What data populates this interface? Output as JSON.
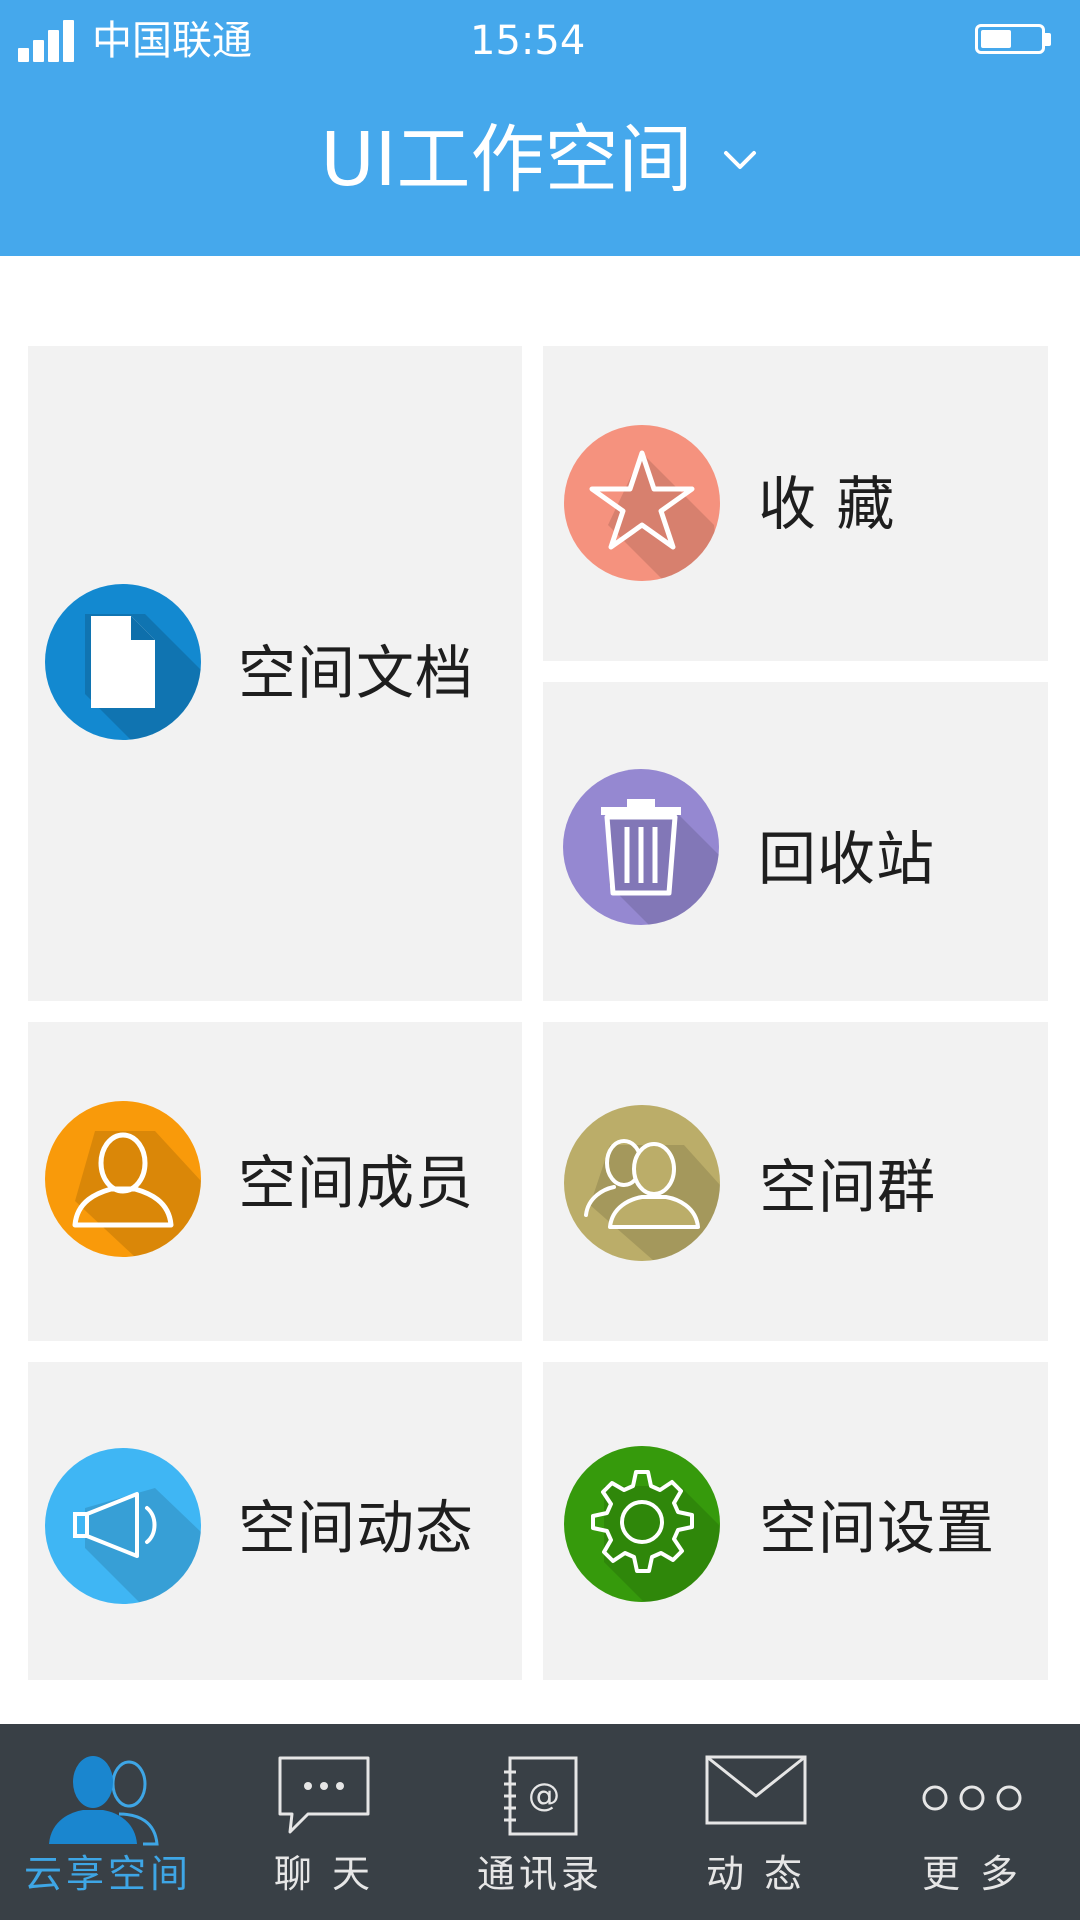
{
  "status_bar": {
    "carrier": "中国联通",
    "time": "15:54"
  },
  "header": {
    "title": "UI工作空间",
    "chevron_icon": "chevron-down-icon"
  },
  "tiles": {
    "documents": {
      "label": "空间文档",
      "icon": "document-icon",
      "color": "#1389d0"
    },
    "favorites": {
      "label": "收 藏",
      "icon": "star-icon",
      "color": "#f5927e"
    },
    "recycle": {
      "label": "回收站",
      "icon": "trash-icon",
      "color": "#9588d1"
    },
    "members": {
      "label": "空间成员",
      "icon": "user-icon",
      "color": "#f99a0a"
    },
    "groups": {
      "label": "空间群",
      "icon": "group-icon",
      "color": "#bbad69"
    },
    "activity": {
      "label": "空间动态",
      "icon": "megaphone-icon",
      "color": "#3fb6f4"
    },
    "settings": {
      "label": "空间设置",
      "icon": "gear-icon",
      "color": "#369a0c"
    }
  },
  "bottom_nav": {
    "items": [
      {
        "label": "云享空间",
        "icon": "users-icon",
        "active": true
      },
      {
        "label": "聊 天",
        "icon": "chat-bubble-icon",
        "active": false
      },
      {
        "label": "通讯录",
        "icon": "address-book-icon",
        "active": false
      },
      {
        "label": "动 态",
        "icon": "envelope-icon",
        "active": false
      },
      {
        "label": "更 多",
        "icon": "more-dots-icon",
        "active": false
      }
    ]
  },
  "colors": {
    "header_bg": "#45a8ec",
    "tile_bg": "#f2f2f2",
    "nav_bg": "#394046",
    "nav_active": "#3ea6e6"
  }
}
